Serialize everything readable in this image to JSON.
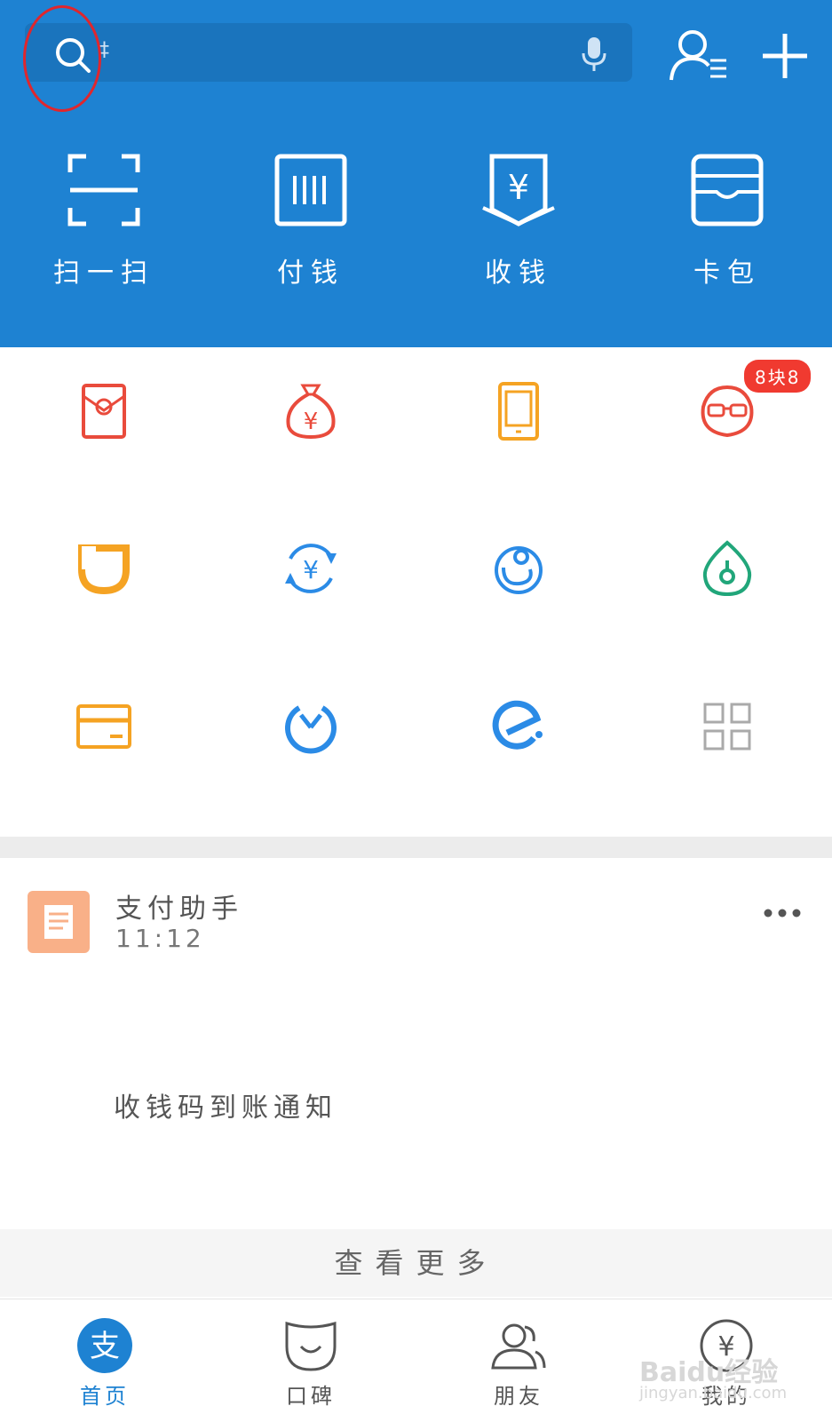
{
  "search": {
    "placeholder": "‡"
  },
  "quick_actions": [
    {
      "label": "扫一扫",
      "icon": "scan-icon"
    },
    {
      "label": "付钱",
      "icon": "barcode-icon"
    },
    {
      "label": "收钱",
      "icon": "receive-money-icon"
    },
    {
      "label": "卡包",
      "icon": "wallet-icon"
    }
  ],
  "grid_badge": "8块8",
  "grid_icons": [
    "red-envelope-icon",
    "money-bag-icon",
    "phone-recharge-icon",
    "glasses-face-icon",
    "didi-icon",
    "transfer-icon",
    "ant-icon",
    "drop-icon",
    "card-icon",
    "clock-icon",
    "ele-icon",
    "more-grid-icon"
  ],
  "message": {
    "title": "支付助手",
    "time": "11:12",
    "body": "收钱码到账通知"
  },
  "see_more": "查看更多",
  "tabs": [
    {
      "label": "首页",
      "icon": "home-icon"
    },
    {
      "label": "口碑",
      "icon": "koubei-icon"
    },
    {
      "label": "朋友",
      "icon": "friends-icon"
    },
    {
      "label": "我的",
      "icon": "mine-icon"
    }
  ],
  "watermark": {
    "text": "Baidu经验",
    "sub": "jingyan.baidu.com"
  },
  "colors": {
    "primary": "#1E82D2",
    "red": "#e94b3c",
    "orange": "#f5a323",
    "blue": "#2b8be6",
    "green": "#21a67a"
  }
}
